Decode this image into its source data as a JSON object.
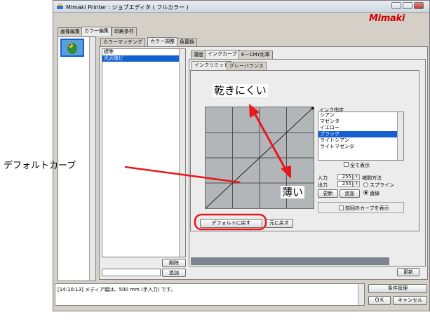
{
  "window": {
    "title": "Mimaki Printer : ジョブエディタ ( フルカラー )",
    "logo": "Mimaki"
  },
  "top_tabs": [
    "画像編集",
    "カラー編集",
    "印刷条件"
  ],
  "sub_tabs": [
    "カラーマッチング",
    "カラー調整",
    "色置換"
  ],
  "profile_list": {
    "items": [
      "標準",
      "光沢塩ビ"
    ],
    "delete_label": "削除",
    "add_label": "追加"
  },
  "inner_tabs": [
    "濃度",
    "インクカーブ",
    "K－CMY比率"
  ],
  "curve_tabs": [
    "インクリミット",
    "グレーバランス"
  ],
  "ink_panel": {
    "heading": "インク指定",
    "inks": [
      "シアン",
      "マゼンタ",
      "イエロー",
      "ブラック",
      "ライトシアン",
      "ライトマゼンタ"
    ],
    "show_all_label": "全て表示",
    "input_label": "入力",
    "input_value": "255",
    "output_label": "出力",
    "output_value": "255",
    "interp_label": "補間方法",
    "spline_label": "スプライン",
    "linear_label": "直線",
    "update_label": "更新",
    "add_label": "追加",
    "prev_curve_label": "前回のカーブを表示"
  },
  "buttons": {
    "default_label": "デフォルトに戻す",
    "restore_label": "元に戻す",
    "update_label": "更新",
    "conditions_label": "条件管理",
    "ok_label": "ＯＫ",
    "cancel_label": "キャンセル"
  },
  "annotations": {
    "hard_to_dry": "乾きにくい",
    "light": "薄い",
    "default_curve": "デフォルトカーブ"
  },
  "log_text": "[14:10:13] メディア幅は、500 mm (手入力) です。",
  "colors": {
    "accent": "#1560d0",
    "annotation": "#e8171d",
    "logo": "#d00000"
  }
}
